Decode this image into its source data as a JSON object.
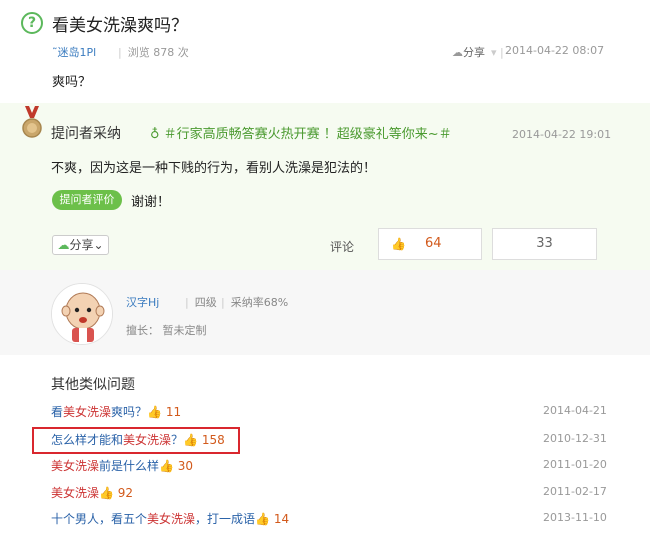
{
  "question": {
    "icon": "question-mark-icon",
    "title": "看美女洗澡爽吗？",
    "user": "˜迷岛1Pl",
    "views": "浏览 878 次",
    "share": "分享",
    "date": "2014-04-22 08:07",
    "body": "爽吗？"
  },
  "answer": {
    "asker_label": "提问者采纳",
    "promo": "＃行家高质畅答赛火热开赛 ！超级豪礼等你来~＃",
    "date": "2014-04-22 19:01",
    "text": "不爽，因为这是一种下贱的行为，看别人洗澡是犯法的！",
    "eval_badge": "提问者评价",
    "thanks": "谢谢！",
    "share": "分享",
    "comment_label": "评论",
    "up_count": "64",
    "down_count": "33"
  },
  "profile": {
    "name": "汉字Hj",
    "level": "四级",
    "rate": "采纳率68%",
    "skill": "擅长：  暂未定制"
  },
  "similar": {
    "title": "其他类似问题",
    "items": [
      {
        "pre": "看",
        "hl": "美女洗澡",
        "post": "爽吗？",
        "count": "11",
        "date": "2014-04-21"
      },
      {
        "pre": "怎么样才能和",
        "hl": "美女洗澡",
        "post": "？",
        "count": "158",
        "date": "2010-12-31"
      },
      {
        "pre": "",
        "hl": "美女洗澡",
        "post": "前是什么样",
        "count": "30",
        "date": "2011-01-20"
      },
      {
        "pre": "",
        "hl": "美女洗澡",
        "post": "",
        "count": "92",
        "date": "2011-02-17"
      },
      {
        "pre": "十个男人，看五个",
        "hl": "美女洗澡",
        "post": "，打一成语",
        "count": "14",
        "date": "2013-11-10"
      }
    ]
  },
  "colors": {
    "accent_green": "#6cc04a",
    "highlight_red": "#d9272e",
    "link_blue": "#2a62a8"
  }
}
